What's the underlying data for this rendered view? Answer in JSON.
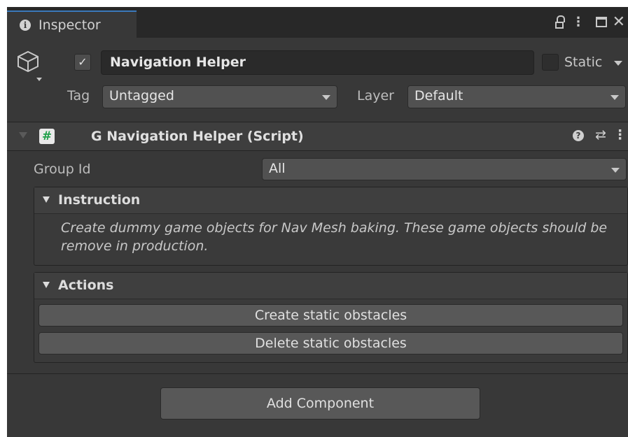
{
  "window": {
    "tab_label": "Inspector",
    "tab_icon": "info-icon",
    "controls": [
      "lock-icon",
      "kebab-menu-icon",
      "maximize-icon",
      "close-icon"
    ]
  },
  "gameobject": {
    "active": true,
    "active_check": "✓",
    "name": "Navigation Helper",
    "static_label": "Static",
    "static_checked": false,
    "tag_label": "Tag",
    "tag_value": "Untagged",
    "layer_label": "Layer",
    "layer_value": "Default"
  },
  "component": {
    "title": "G Navigation Helper (Script)",
    "script_glyph": "#",
    "icons": [
      "help-icon",
      "presets-icon",
      "kebab-menu-icon"
    ],
    "group_id_label": "Group Id",
    "group_id_value": "All",
    "instruction": {
      "title": "Instruction",
      "text": "Create dummy game objects for Nav Mesh baking. These game objects should be remove in production."
    },
    "actions": {
      "title": "Actions",
      "buttons": [
        "Create static obstacles",
        "Delete static obstacles"
      ]
    }
  },
  "footer": {
    "add_component_label": "Add Component"
  },
  "colors": {
    "background": "#383838",
    "tab_accent": "#3a79bb",
    "button": "#585858",
    "field": "#515151",
    "text": "#d2d2d2"
  }
}
